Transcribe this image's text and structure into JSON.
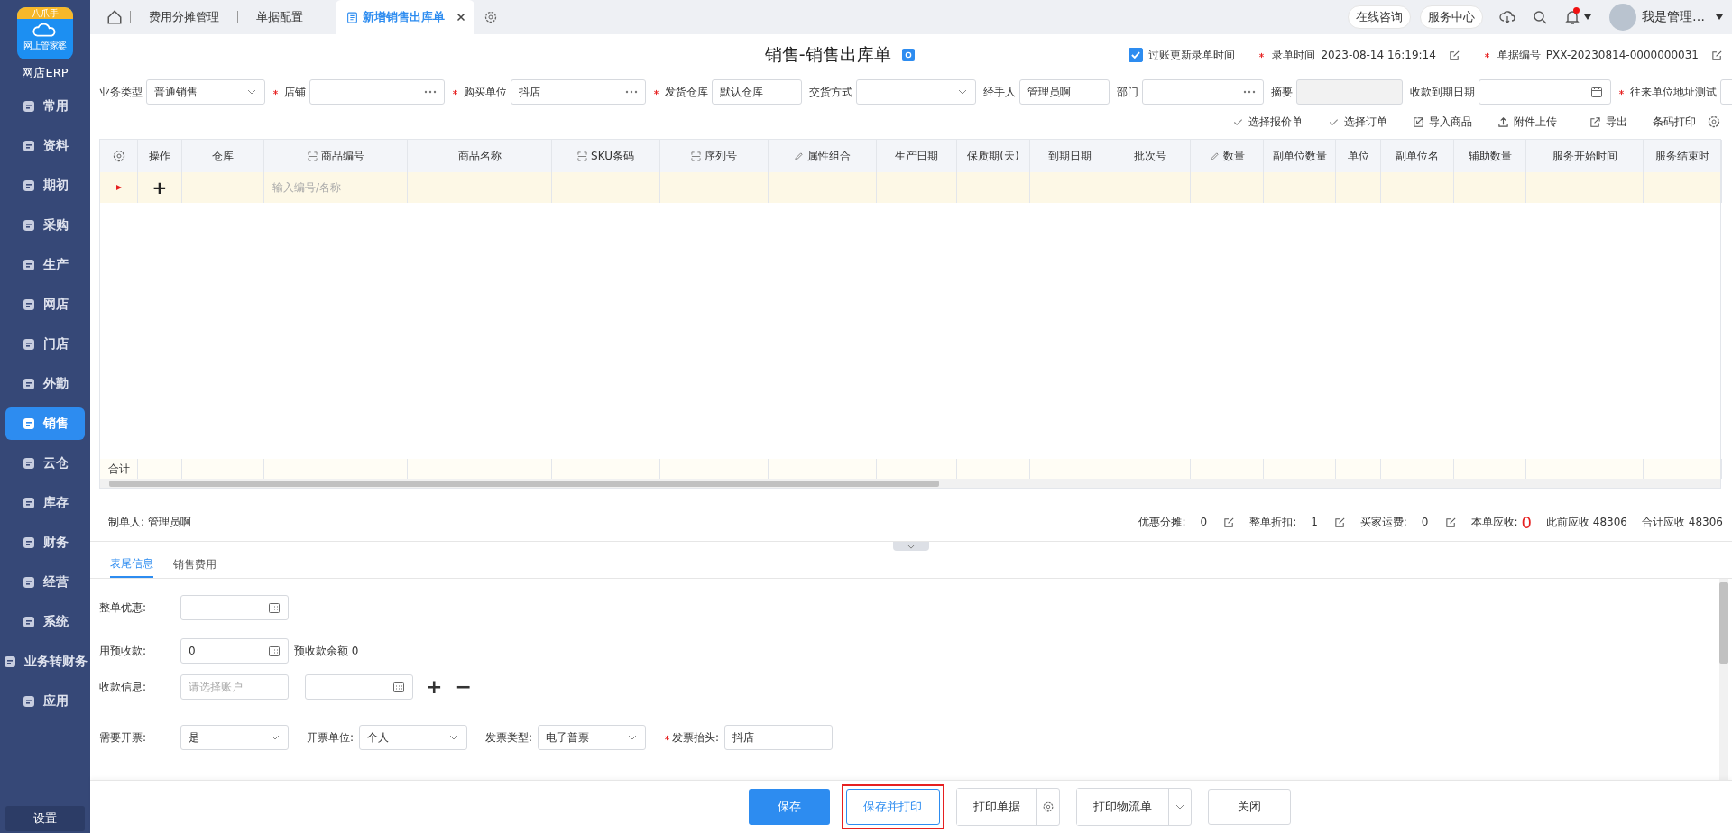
{
  "sidebar": {
    "logo_badge": "八爪手",
    "logo_caption": "网上管家婆",
    "brand": "网店ERP",
    "items": [
      {
        "label": "常用",
        "selected": false
      },
      {
        "label": "资料",
        "selected": false
      },
      {
        "label": "期初",
        "selected": false
      },
      {
        "label": "采购",
        "selected": false
      },
      {
        "label": "生产",
        "selected": false
      },
      {
        "label": "网店",
        "selected": false
      },
      {
        "label": "门店",
        "selected": false
      },
      {
        "label": "外勤",
        "selected": false
      },
      {
        "label": "销售",
        "selected": true
      },
      {
        "label": "云仓",
        "selected": false
      },
      {
        "label": "库存",
        "selected": false
      },
      {
        "label": "财务",
        "selected": false
      },
      {
        "label": "经营",
        "selected": false
      },
      {
        "label": "系统",
        "selected": false
      },
      {
        "label": "业务转财务",
        "selected": false
      },
      {
        "label": "应用",
        "selected": false
      }
    ],
    "settings": "设置"
  },
  "tabs": [
    {
      "label": "费用分摊管理",
      "selected": false,
      "closable": false
    },
    {
      "label": "单据配置",
      "selected": false,
      "closable": false
    },
    {
      "label": "新增销售出库单",
      "selected": true,
      "closable": true
    }
  ],
  "topbar": {
    "buttons": [
      "在线咨询",
      "服务中心"
    ],
    "notification": true,
    "user": "我是管理…"
  },
  "title": "销售-销售出库单",
  "meta": {
    "checkbox": {
      "label": "过账更新录单时间",
      "checked": true
    },
    "items": [
      {
        "label": "录单时间",
        "value": "2023-08-14 16:19:14",
        "required": true
      },
      {
        "label": "单据编号",
        "value": "PXX-20230814-0000000031",
        "required": true
      }
    ]
  },
  "fields": [
    {
      "label": "业务类型",
      "kind": "select",
      "value": "普通销售",
      "required": false
    },
    {
      "label": "店铺",
      "kind": "lookup",
      "required": true
    },
    {
      "label": "购买单位",
      "kind": "lookup",
      "value": "抖店",
      "required": true
    },
    {
      "label": "发货仓库",
      "kind": "text",
      "value": "默认仓库",
      "required": true
    },
    {
      "label": "交货方式",
      "kind": "select",
      "required": false
    },
    {
      "label": "经手人",
      "kind": "text",
      "value": "管理员啊",
      "required": false
    },
    {
      "label": "部门",
      "kind": "lookup",
      "required": false
    },
    {
      "label": "摘要",
      "kind": "disabled",
      "required": false
    },
    {
      "label": "收款到期日期",
      "kind": "date",
      "required": false
    },
    {
      "label": "往来单位地址测试",
      "kind": "text",
      "required": true
    }
  ],
  "toolbar": [
    {
      "label": "选择报价单",
      "kind": "check"
    },
    {
      "label": "选择订单",
      "kind": "check"
    },
    {
      "label": "导入商品",
      "kind": "import"
    },
    {
      "label": "附件上传",
      "kind": "upload"
    },
    {
      "label": "导出",
      "kind": "export"
    },
    {
      "label": "条码打印",
      "kind": "plain"
    }
  ],
  "table": {
    "columns": [
      {
        "label": "操作",
        "kind": "plain"
      },
      {
        "label": "仓库",
        "kind": "plain"
      },
      {
        "label": "商品编号",
        "kind": "scan"
      },
      {
        "label": "商品名称",
        "kind": "plain"
      },
      {
        "label": "SKU条码",
        "kind": "scan"
      },
      {
        "label": "序列号",
        "kind": "scan"
      },
      {
        "label": "属性组合",
        "kind": "edit"
      },
      {
        "label": "生产日期",
        "kind": "plain"
      },
      {
        "label": "保质期(天)",
        "kind": "plain"
      },
      {
        "label": "到期日期",
        "kind": "plain"
      },
      {
        "label": "批次号",
        "kind": "plain"
      },
      {
        "label": "数量",
        "kind": "edit"
      },
      {
        "label": "副单位数量",
        "kind": "plain"
      },
      {
        "label": "单位",
        "kind": "plain"
      },
      {
        "label": "副单位名",
        "kind": "plain"
      },
      {
        "label": "辅助数量",
        "kind": "plain"
      },
      {
        "label": "服务开始时间",
        "kind": "plain"
      },
      {
        "label": "服务结束时",
        "kind": "plain"
      }
    ],
    "add_symbol": "+",
    "input_placeholder": "输入编号/名称",
    "total_label": "合计"
  },
  "summary": {
    "creator_label": "制单人:",
    "creator": "管理员啊",
    "items": [
      {
        "label": "优惠分摊:",
        "value": "0",
        "editable": true
      },
      {
        "label": "整单折扣:",
        "value": "1",
        "editable": true
      },
      {
        "label": "买家运费:",
        "value": "0",
        "editable": true
      }
    ],
    "receivable_label": "本单应收:",
    "receivable": "0",
    "previous": "此前应收 48306",
    "total": "合计应收 48306"
  },
  "bottom_tabs": [
    {
      "label": "表尾信息",
      "selected": true
    },
    {
      "label": "销售费用",
      "selected": false
    }
  ],
  "footer_form": {
    "discount_label": "整单优惠:",
    "prepay_label": "用预收款:",
    "prepay_value": "0",
    "prepay_balance": "预收款余额 0",
    "payment_label": "收款信息:",
    "payment_placeholder": "请选择账户",
    "add": "+",
    "remove": "−",
    "invoice": [
      {
        "label": "需要开票:",
        "kind": "select",
        "value": "是",
        "required": false
      },
      {
        "label": "开票单位:",
        "kind": "select",
        "value": "个人",
        "required": false
      },
      {
        "label": "发票类型:",
        "kind": "select",
        "value": "电子普票",
        "required": false
      },
      {
        "label": "发票抬头:",
        "kind": "text",
        "value": "抖店",
        "required": true
      }
    ]
  },
  "actions": [
    {
      "label": "保存",
      "kind": "primary",
      "highlighted": false
    },
    {
      "label": "保存并打印",
      "kind": "outline",
      "highlighted": true
    },
    {
      "label": "打印单据",
      "kind": "gear",
      "highlighted": false
    },
    {
      "label": "打印物流单",
      "kind": "split",
      "highlighted": false
    },
    {
      "label": "关闭",
      "kind": "plain",
      "highlighted": false
    }
  ]
}
